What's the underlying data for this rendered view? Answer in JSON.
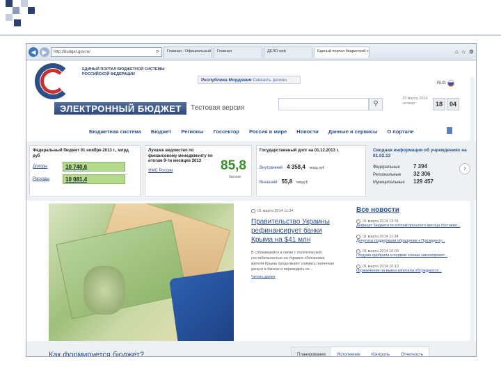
{
  "browser": {
    "address": "http://budget.gov.ru/",
    "tabs": [
      "Главная - Официальный сайт...",
      "Главная",
      "ДЕЛО web",
      "Единый портал бюджетной с..."
    ]
  },
  "header": {
    "portal_name": "ЕДИНЫЙ ПОРТАЛ БЮДЖЕТНОЙ СИСТЕМЫ РОССИЙСКОЙ ФЕДЕРАЦИИ",
    "brand": "ЭЛЕКТРОННЫЙ БЮДЖЕТ",
    "test_version": "Тестовая версия",
    "region": "Республика Мордовия",
    "change_region": "Сменить регион",
    "lang": "RUS",
    "date_text": "13 марта 2014 четверг",
    "hour": "18",
    "minute": "04"
  },
  "menu": [
    "Бюджетная система",
    "Бюджет",
    "Регионы",
    "Госсектор",
    "Россия в мире",
    "Новости",
    "Данные и сервисы",
    "О портале"
  ],
  "info": {
    "federal": {
      "title": "Федеральный бюджет 01 ноября 2013 г., млрд руб",
      "income_label": "Доходы",
      "income_value": "10 740,6",
      "expense_label": "Расходы",
      "expense_value": "10 081,4"
    },
    "best": {
      "title": "Лучшее ведомство по финансовому менеджменту по итогам 9-ти месяцев 2013",
      "agency": "ФМС России",
      "score": "85,8",
      "score_label": "баллов"
    },
    "debt": {
      "title": "Государственный долг на 01.12.2013 г.",
      "internal_label": "Внутренний",
      "internal_value": "4 358,4",
      "internal_unit": "млрд руб",
      "external_label": "Внешний",
      "external_value": "55,8",
      "external_unit": "млрд $"
    },
    "institutions": {
      "title": "Сводная информация об учреждениях на 01.02.13",
      "rows": [
        {
          "label": "Федеральные",
          "value": "7 394"
        },
        {
          "label": "Региональные",
          "value": "32 306"
        },
        {
          "label": "Муниципальные",
          "value": "129 457"
        }
      ]
    }
  },
  "main_news": {
    "date": "01 марта 2014 11:34",
    "title": "Правительство Украины рефинансирует банки Крыма на $41 млн",
    "text": "В сложившейся в связи с политической нестабильностью на Украине обстановке жители Крыма продолжают снимать наличные деньги в банках и переводить их...",
    "more": "Читать далее"
  },
  "news_list": {
    "title": "Все новости",
    "items": [
      {
        "date": "01 марта 2014 13:31",
        "text": "Дефицит бюджета по итогам прошлого месяца составил..."
      },
      {
        "date": "01 марта 2014 11:34",
        "text": "Депутаты поддержали обращение к Президенту..."
      },
      {
        "date": "01 марта 2014 10:09",
        "text": "Госдума одобрила в первом чтении законопроект..."
      },
      {
        "date": "01 марта 2014 10:13",
        "text": "Ограничения на вывоз капитала обсуждаются..."
      }
    ]
  },
  "bottom": {
    "how_budget": "Как формируется бюджет?",
    "tabs": [
      "Планирование",
      "Исполнение",
      "Контроль",
      "Отчетность"
    ]
  }
}
